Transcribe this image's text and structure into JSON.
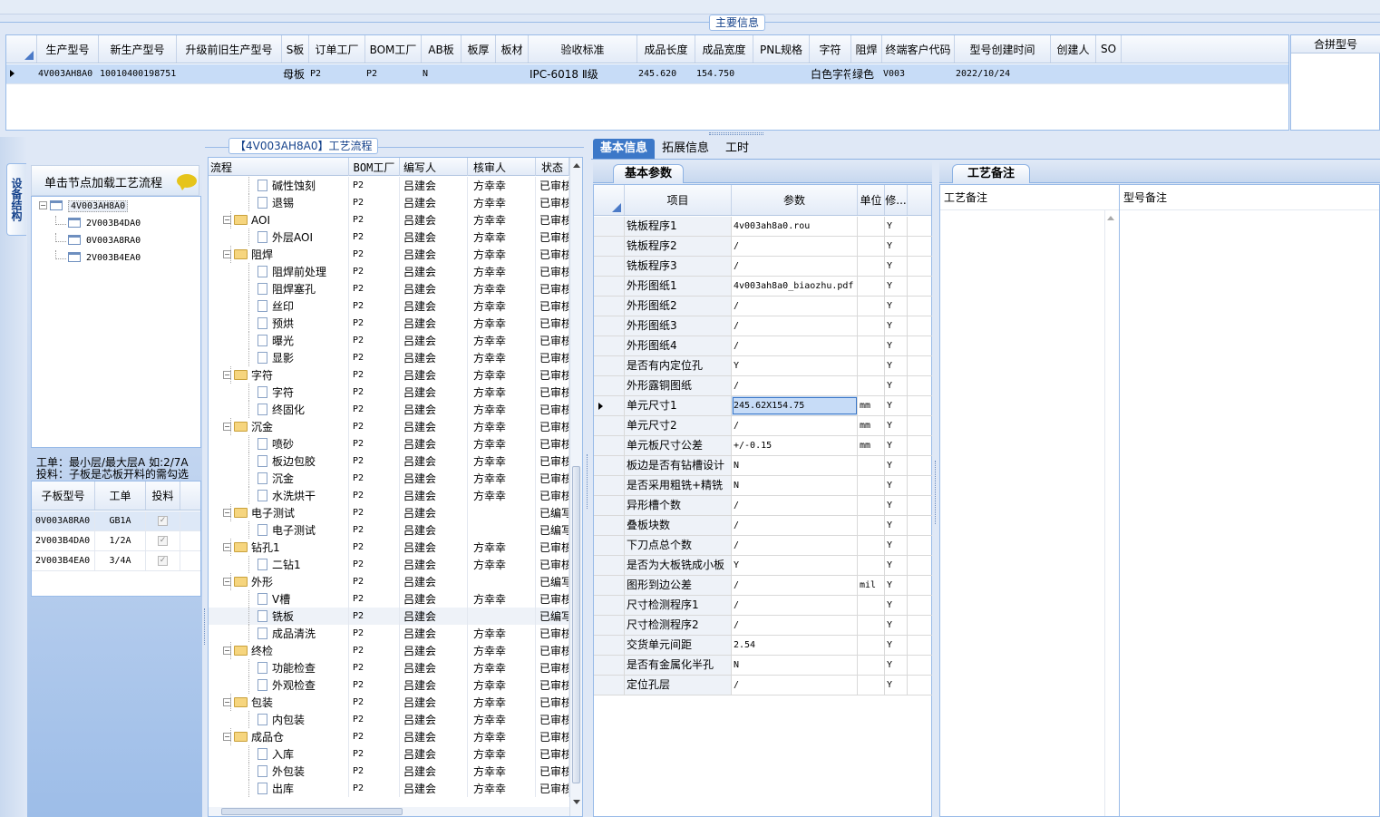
{
  "main_group_title": "主要信息",
  "main_grid": {
    "headers": [
      "生产型号",
      "新生产型号",
      "升级前旧生产型号",
      "S板",
      "订单工厂",
      "BOM工厂",
      "AB板",
      "板厚",
      "板材",
      "验收标准",
      "成品长度",
      "成品宽度",
      "PNL规格",
      "字符",
      "阻焊",
      "终端客户代码",
      "型号创建时间",
      "创建人",
      "SO"
    ],
    "row": [
      "4V003AH8A0",
      "10010400198751",
      "",
      "母板",
      "P2",
      "P2",
      "N",
      "",
      "",
      "IPC-6018 Ⅱ级",
      "245.620",
      "154.750",
      "",
      "白色字符",
      "绿色",
      "V003",
      "2022/10/24",
      "",
      ""
    ]
  },
  "merge_panel_header": "合拼型号",
  "side_tab": "设备结构",
  "left_panel": {
    "click_hint": "单击节点加载工艺流程",
    "tree": [
      "4V003AH8A0",
      "2V003B4DA0",
      "0V003A8RA0",
      "2V003B4EA0"
    ],
    "note_line1": "工单：最小层/最大层A 如:2/7A",
    "note_line2": "投料：子板是芯板开料的需勾选",
    "sub_headers": [
      "子板型号",
      "工单",
      "投料"
    ],
    "sub_rows": [
      [
        "0V003A8RA0",
        "GB1A",
        "✓"
      ],
      [
        "2V003B4DA0",
        "1/2A",
        "✓"
      ],
      [
        "2V003B4EA0",
        "3/4A",
        "✓"
      ]
    ]
  },
  "flow_panel": {
    "title": "【4V003AH8A0】工艺流程",
    "headers": [
      "流程",
      "BOM工厂",
      "编写人",
      "核审人",
      "状态"
    ],
    "rows": [
      {
        "name": "碱性蚀刻",
        "level": 2,
        "folder": false,
        "bom": "P2",
        "writer": "吕建会",
        "reviewer": "方幸幸",
        "status": "已审核"
      },
      {
        "name": "退锡",
        "level": 2,
        "folder": false,
        "bom": "P2",
        "writer": "吕建会",
        "reviewer": "方幸幸",
        "status": "已审核"
      },
      {
        "name": "AOI",
        "level": 1,
        "folder": true,
        "bom": "P2",
        "writer": "吕建会",
        "reviewer": "方幸幸",
        "status": "已审核"
      },
      {
        "name": "外层AOI",
        "level": 2,
        "folder": false,
        "bom": "P2",
        "writer": "吕建会",
        "reviewer": "方幸幸",
        "status": "已审核"
      },
      {
        "name": "阻焊",
        "level": 1,
        "folder": true,
        "bom": "P2",
        "writer": "吕建会",
        "reviewer": "方幸幸",
        "status": "已审核"
      },
      {
        "name": "阻焊前处理",
        "level": 2,
        "folder": false,
        "bom": "P2",
        "writer": "吕建会",
        "reviewer": "方幸幸",
        "status": "已审核"
      },
      {
        "name": "阻焊塞孔",
        "level": 2,
        "folder": false,
        "bom": "P2",
        "writer": "吕建会",
        "reviewer": "方幸幸",
        "status": "已审核"
      },
      {
        "name": "丝印",
        "level": 2,
        "folder": false,
        "bom": "P2",
        "writer": "吕建会",
        "reviewer": "方幸幸",
        "status": "已审核"
      },
      {
        "name": "预烘",
        "level": 2,
        "folder": false,
        "bom": "P2",
        "writer": "吕建会",
        "reviewer": "方幸幸",
        "status": "已审核"
      },
      {
        "name": "曝光",
        "level": 2,
        "folder": false,
        "bom": "P2",
        "writer": "吕建会",
        "reviewer": "方幸幸",
        "status": "已审核"
      },
      {
        "name": "显影",
        "level": 2,
        "folder": false,
        "bom": "P2",
        "writer": "吕建会",
        "reviewer": "方幸幸",
        "status": "已审核"
      },
      {
        "name": "字符",
        "level": 1,
        "folder": true,
        "bom": "P2",
        "writer": "吕建会",
        "reviewer": "方幸幸",
        "status": "已审核"
      },
      {
        "name": "字符",
        "level": 2,
        "folder": false,
        "bom": "P2",
        "writer": "吕建会",
        "reviewer": "方幸幸",
        "status": "已审核"
      },
      {
        "name": "终固化",
        "level": 2,
        "folder": false,
        "bom": "P2",
        "writer": "吕建会",
        "reviewer": "方幸幸",
        "status": "已审核"
      },
      {
        "name": "沉金",
        "level": 1,
        "folder": true,
        "bom": "P2",
        "writer": "吕建会",
        "reviewer": "方幸幸",
        "status": "已审核"
      },
      {
        "name": "喷砂",
        "level": 2,
        "folder": false,
        "bom": "P2",
        "writer": "吕建会",
        "reviewer": "方幸幸",
        "status": "已审核"
      },
      {
        "name": "板边包胶",
        "level": 2,
        "folder": false,
        "bom": "P2",
        "writer": "吕建会",
        "reviewer": "方幸幸",
        "status": "已审核"
      },
      {
        "name": "沉金",
        "level": 2,
        "folder": false,
        "bom": "P2",
        "writer": "吕建会",
        "reviewer": "方幸幸",
        "status": "已审核"
      },
      {
        "name": "水洗烘干",
        "level": 2,
        "folder": false,
        "bom": "P2",
        "writer": "吕建会",
        "reviewer": "方幸幸",
        "status": "已审核"
      },
      {
        "name": "电子测试",
        "level": 1,
        "folder": true,
        "bom": "P2",
        "writer": "吕建会",
        "reviewer": "",
        "status": "已编写"
      },
      {
        "name": "电子测试",
        "level": 2,
        "folder": false,
        "bom": "P2",
        "writer": "吕建会",
        "reviewer": "",
        "status": "已编写"
      },
      {
        "name": "钻孔1",
        "level": 1,
        "folder": true,
        "bom": "P2",
        "writer": "吕建会",
        "reviewer": "方幸幸",
        "status": "已审核"
      },
      {
        "name": "二钻1",
        "level": 2,
        "folder": false,
        "bom": "P2",
        "writer": "吕建会",
        "reviewer": "方幸幸",
        "status": "已审核"
      },
      {
        "name": "外形",
        "level": 1,
        "folder": true,
        "bom": "P2",
        "writer": "吕建会",
        "reviewer": "",
        "status": "已编写"
      },
      {
        "name": "V槽",
        "level": 2,
        "folder": false,
        "bom": "P2",
        "writer": "吕建会",
        "reviewer": "方幸幸",
        "status": "已审核"
      },
      {
        "name": "铣板",
        "level": 2,
        "folder": false,
        "bom": "P2",
        "writer": "吕建会",
        "reviewer": "",
        "status": "已编写"
      },
      {
        "name": "成品清洗",
        "level": 2,
        "folder": false,
        "bom": "P2",
        "writer": "吕建会",
        "reviewer": "方幸幸",
        "status": "已审核"
      },
      {
        "name": "终检",
        "level": 1,
        "folder": true,
        "bom": "P2",
        "writer": "吕建会",
        "reviewer": "方幸幸",
        "status": "已审核"
      },
      {
        "name": "功能检查",
        "level": 2,
        "folder": false,
        "bom": "P2",
        "writer": "吕建会",
        "reviewer": "方幸幸",
        "status": "已审核"
      },
      {
        "name": "外观检查",
        "level": 2,
        "folder": false,
        "bom": "P2",
        "writer": "吕建会",
        "reviewer": "方幸幸",
        "status": "已审核"
      },
      {
        "name": "包装",
        "level": 1,
        "folder": true,
        "bom": "P2",
        "writer": "吕建会",
        "reviewer": "方幸幸",
        "status": "已审核"
      },
      {
        "name": "内包装",
        "level": 2,
        "folder": false,
        "bom": "P2",
        "writer": "吕建会",
        "reviewer": "方幸幸",
        "status": "已审核"
      },
      {
        "name": "成品仓",
        "level": 1,
        "folder": true,
        "bom": "P2",
        "writer": "吕建会",
        "reviewer": "方幸幸",
        "status": "已审核"
      },
      {
        "name": "入库",
        "level": 2,
        "folder": false,
        "bom": "P2",
        "writer": "吕建会",
        "reviewer": "方幸幸",
        "status": "已审核"
      },
      {
        "name": "外包装",
        "level": 2,
        "folder": false,
        "bom": "P2",
        "writer": "吕建会",
        "reviewer": "方幸幸",
        "status": "已审核"
      },
      {
        "name": "出库",
        "level": 2,
        "folder": false,
        "bom": "P2",
        "writer": "吕建会",
        "reviewer": "方幸幸",
        "status": "已审核"
      }
    ]
  },
  "right_tabs": [
    "基本信息",
    "拓展信息",
    "工时"
  ],
  "params": {
    "tab": "基本参数",
    "headers": [
      "项目",
      "参数",
      "单位",
      "修..."
    ],
    "rows": [
      [
        "铣板程序1",
        "4v003ah8a0.rou",
        "",
        "Y"
      ],
      [
        "铣板程序2",
        "/",
        "",
        "Y"
      ],
      [
        "铣板程序3",
        "/",
        "",
        "Y"
      ],
      [
        "外形图纸1",
        "4v003ah8a0_biaozhu.pdf",
        "",
        "Y"
      ],
      [
        "外形图纸2",
        "/",
        "",
        "Y"
      ],
      [
        "外形图纸3",
        "/",
        "",
        "Y"
      ],
      [
        "外形图纸4",
        "/",
        "",
        "Y"
      ],
      [
        "是否有内定位孔",
        "Y",
        "",
        "Y"
      ],
      [
        "外形露铜图纸",
        "/",
        "",
        "Y"
      ],
      [
        "单元尺寸1",
        "245.62X154.75",
        "mm",
        "Y"
      ],
      [
        "单元尺寸2",
        "/",
        "mm",
        "Y"
      ],
      [
        "单元板尺寸公差",
        "+/-0.15",
        "mm",
        "Y"
      ],
      [
        "板边是否有钻槽设计",
        "N",
        "",
        "Y"
      ],
      [
        "是否采用粗铣+精铣",
        "N",
        "",
        "Y"
      ],
      [
        "异形槽个数",
        "/",
        "",
        "Y"
      ],
      [
        "叠板块数",
        "/",
        "",
        "Y"
      ],
      [
        "下刀点总个数",
        "/",
        "",
        "Y"
      ],
      [
        "是否为大板铣成小板",
        "Y",
        "",
        "Y"
      ],
      [
        "图形到边公差",
        "/",
        "mil",
        "Y"
      ],
      [
        "尺寸检测程序1",
        "/",
        "",
        "Y"
      ],
      [
        "尺寸检测程序2",
        "/",
        "",
        "Y"
      ],
      [
        "交货单元间距",
        "2.54",
        "",
        "Y"
      ],
      [
        "是否有金属化半孔",
        "N",
        "",
        "Y"
      ],
      [
        "定位孔层",
        "/",
        "",
        "Y"
      ]
    ]
  },
  "remarks": {
    "tab": "工艺备注",
    "col1": "工艺备注",
    "col2": "型号备注"
  }
}
